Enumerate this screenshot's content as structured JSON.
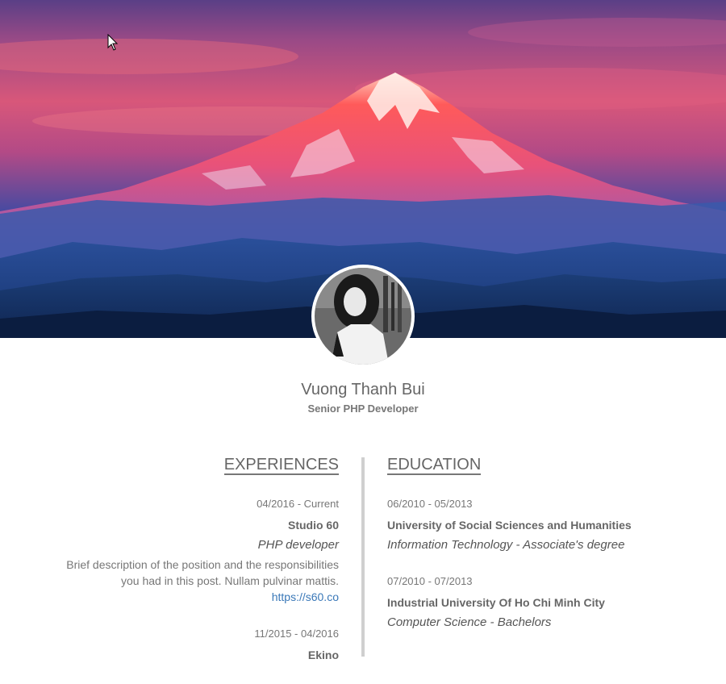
{
  "profile": {
    "name": "Vuong Thanh Bui",
    "title": "Senior PHP Developer"
  },
  "hero": {
    "icon": "mountain-landscape"
  },
  "experiences": {
    "heading": "EXPERIENCES",
    "items": [
      {
        "date": "04/2016 - Current",
        "company": "Studio 60",
        "position": "PHP developer",
        "description": "Brief description of the position and the responsibilities you had in this post. Nullam pulvinar mattis.",
        "link": "https://s60.co"
      },
      {
        "date": "11/2015 - 04/2016",
        "company": "Ekino"
      }
    ]
  },
  "education": {
    "heading": "EDUCATION",
    "items": [
      {
        "date": "06/2010 - 05/2013",
        "school": "University of Social Sciences and Humanities",
        "degree": "Information Technology - Associate's degree"
      },
      {
        "date": "07/2010 - 07/2013",
        "school": "Industrial University Of Ho Chi Minh City",
        "degree": "Computer Science - Bachelors"
      }
    ]
  },
  "colors": {
    "link": "#3a78b8",
    "divider": "#cfcfcf",
    "text": "#555555"
  }
}
